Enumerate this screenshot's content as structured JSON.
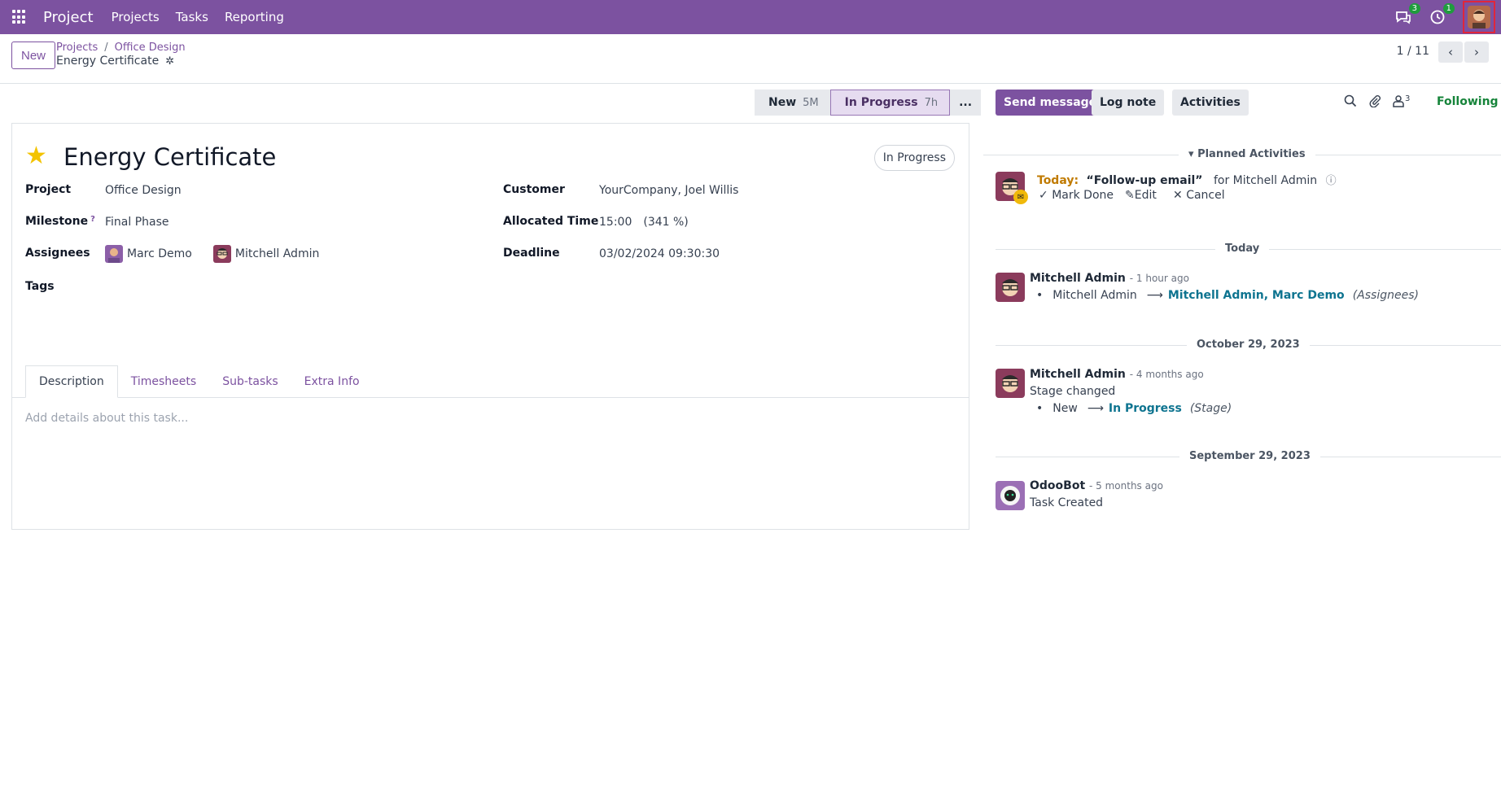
{
  "navbar": {
    "brand": "Project",
    "menus": [
      "Projects",
      "Tasks",
      "Reporting"
    ],
    "messages_badge": "3",
    "activities_badge": "1",
    "bg_color": "#7c52a0"
  },
  "control_panel": {
    "new_button": "New",
    "breadcrumb": [
      "Projects",
      "Office Design"
    ],
    "breadcrumb_sep": "/",
    "current": "Energy Certificate",
    "pager": "1 / 11"
  },
  "statusbar": {
    "stages": [
      {
        "label": "New",
        "duration": "5M"
      },
      {
        "label": "In Progress",
        "duration": "7h"
      }
    ],
    "more": "..."
  },
  "form": {
    "title": "Energy Certificate",
    "state": "In Progress",
    "project_label": "Project",
    "project_value": "Office Design",
    "milestone_label": "Milestone",
    "milestone_help": "?",
    "milestone_value": "Final Phase",
    "assignees_label": "Assignees",
    "assignees": [
      "Marc Demo",
      "Mitchell Admin"
    ],
    "tags_label": "Tags",
    "customer_label": "Customer",
    "customer_value": "YourCompany, Joel Willis",
    "allocated_label": "Allocated Time",
    "allocated_value": "15:00",
    "allocated_pct": "(341 %)",
    "deadline_label": "Deadline",
    "deadline_value": "03/02/2024 09:30:30",
    "tabs": [
      "Description",
      "Timesheets",
      "Sub-tasks",
      "Extra Info"
    ],
    "description_placeholder": "Add details about this task..."
  },
  "chatter": {
    "send_message": "Send message",
    "log_note": "Log note",
    "activities": "Activities",
    "followers_count": "3",
    "following": "Following",
    "planned_title": "Planned Activities",
    "activity": {
      "today": "Today:",
      "summary": "“Follow-up email”",
      "for": "for Mitchell Admin",
      "mark_done": "Mark Done",
      "edit": "Edit",
      "cancel": "Cancel"
    },
    "groups": [
      {
        "date": "Today",
        "author": "Mitchell Admin",
        "when": "- 1 hour ago",
        "old": "Mitchell Admin",
        "new": "Mitchell Admin, Marc Demo",
        "field": "(Assignees)"
      },
      {
        "date": "October 29, 2023",
        "author": "Mitchell Admin",
        "when": "- 4 months ago",
        "body": "Stage changed",
        "old": "New",
        "new": "In Progress",
        "field": "(Stage)"
      },
      {
        "date": "September 29, 2023",
        "author": "OdooBot",
        "when": "- 5 months ago",
        "body": "Task Created"
      }
    ]
  }
}
